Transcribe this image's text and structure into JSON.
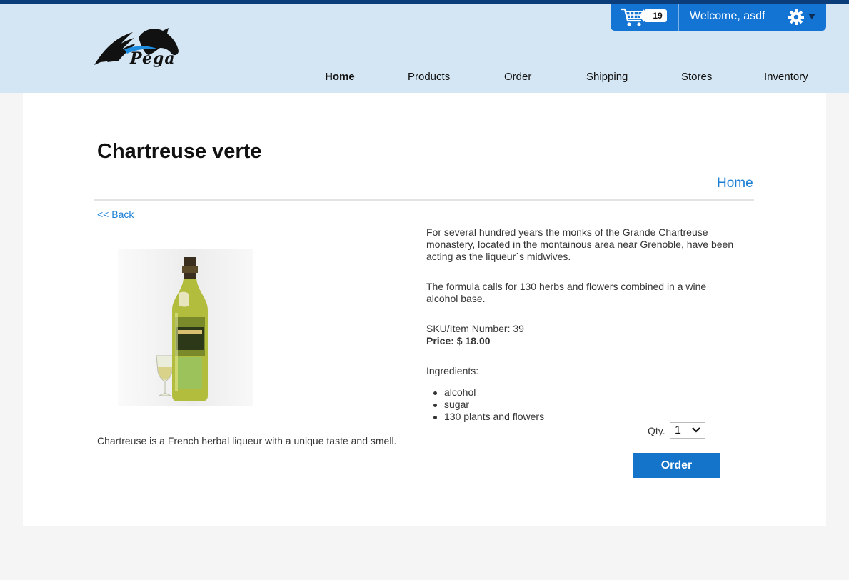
{
  "brand": {
    "logo_text": "Pega"
  },
  "userbar": {
    "cart_count": "19",
    "welcome": "Welcome, asdf",
    "cart_icon": "shopping-cart-icon",
    "settings_icon": "gear-icon"
  },
  "nav": {
    "items": [
      {
        "label": "Home",
        "active": true
      },
      {
        "label": "Products"
      },
      {
        "label": "Order"
      },
      {
        "label": "Shipping"
      },
      {
        "label": "Stores"
      },
      {
        "label": "Inventory"
      }
    ]
  },
  "product": {
    "title": "Chartreuse verte",
    "home_link": "Home",
    "back_link": "<< Back",
    "short_description": "Chartreuse is a French herbal liqueur with a unique taste and smell.",
    "paragraph1": "For several hundred years the monks of the Grande Chartreuse monastery, located in the montainous area near Grenoble, have been acting as the liqueur´s midwives.",
    "paragraph2": "The formula calls for 130 herbs and flowers combined in a wine alcohol base.",
    "sku": "SKU/Item Number: 39",
    "price": "Price: $ 18.00",
    "ingredients_label": "Ingredients:",
    "ingredients": [
      "alcohol",
      "sugar",
      "130 plants and flowers"
    ]
  },
  "order": {
    "qty_label": "Qty.",
    "qty_value": "1",
    "button_label": "Order"
  },
  "colors": {
    "header_bg": "#d4e6f3",
    "accent": "#1474d4",
    "link": "#1a7fd4",
    "top_strip": "#0a3d7a"
  }
}
